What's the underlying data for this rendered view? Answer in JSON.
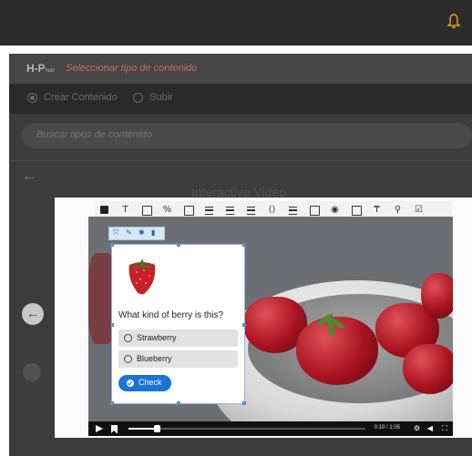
{
  "colors": {
    "accent": "#1a73d9",
    "bell": "#e0a020",
    "topbar": "#2b2b2b"
  },
  "topbar": {
    "bell_icon": "bell-icon"
  },
  "h5p": {
    "logo": "H-P",
    "logo_suffix": "hub",
    "title": "Seleccionar tipo de contenido",
    "options": [
      {
        "label": "Crear Contenido",
        "selected": true
      },
      {
        "label": "Subir",
        "selected": false
      }
    ],
    "search_placeholder": "Buscar tipos de contenido",
    "back_icon": "←",
    "section_title": "Interactive Video"
  },
  "editor": {
    "toolbar_icons": [
      "text-icon",
      "table-icon",
      "link-icon",
      "image-icon",
      "statements-icon",
      "single-choice-icon",
      "multi-choice-icon",
      "drag-text-icon",
      "mark-words-icon",
      "summary-icon",
      "hotspot-icon",
      "crossroads-icon",
      "bookmark-icon",
      "goal-icon",
      "submit-icon"
    ],
    "mini_toolbar_icons": [
      "move-icon",
      "edit-icon",
      "star-icon",
      "delete-icon"
    ]
  },
  "question_card": {
    "question": "What kind of berry is this?",
    "answers": [
      "Strawberry",
      "Blueberry"
    ],
    "check_label": "Check"
  },
  "player": {
    "progress_fraction": 0.12,
    "time": "0:10 / 1:05"
  }
}
